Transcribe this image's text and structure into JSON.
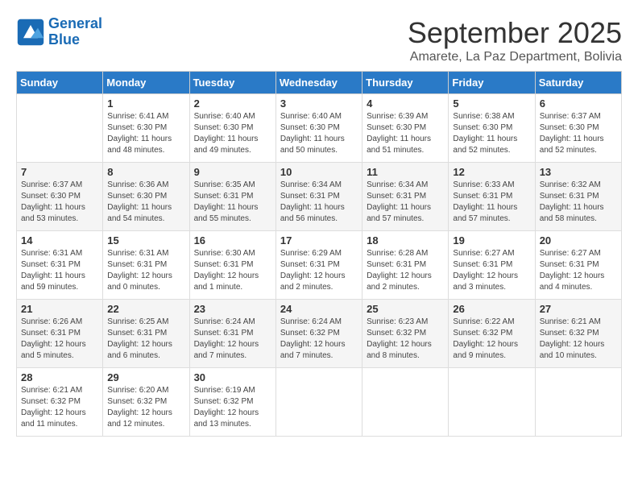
{
  "logo": {
    "line1": "General",
    "line2": "Blue"
  },
  "title": "September 2025",
  "subtitle": "Amarete, La Paz Department, Bolivia",
  "days_of_week": [
    "Sunday",
    "Monday",
    "Tuesday",
    "Wednesday",
    "Thursday",
    "Friday",
    "Saturday"
  ],
  "weeks": [
    [
      {
        "day": "",
        "info": ""
      },
      {
        "day": "1",
        "info": "Sunrise: 6:41 AM\nSunset: 6:30 PM\nDaylight: 11 hours\nand 48 minutes."
      },
      {
        "day": "2",
        "info": "Sunrise: 6:40 AM\nSunset: 6:30 PM\nDaylight: 11 hours\nand 49 minutes."
      },
      {
        "day": "3",
        "info": "Sunrise: 6:40 AM\nSunset: 6:30 PM\nDaylight: 11 hours\nand 50 minutes."
      },
      {
        "day": "4",
        "info": "Sunrise: 6:39 AM\nSunset: 6:30 PM\nDaylight: 11 hours\nand 51 minutes."
      },
      {
        "day": "5",
        "info": "Sunrise: 6:38 AM\nSunset: 6:30 PM\nDaylight: 11 hours\nand 52 minutes."
      },
      {
        "day": "6",
        "info": "Sunrise: 6:37 AM\nSunset: 6:30 PM\nDaylight: 11 hours\nand 52 minutes."
      }
    ],
    [
      {
        "day": "7",
        "info": "Sunrise: 6:37 AM\nSunset: 6:30 PM\nDaylight: 11 hours\nand 53 minutes."
      },
      {
        "day": "8",
        "info": "Sunrise: 6:36 AM\nSunset: 6:30 PM\nDaylight: 11 hours\nand 54 minutes."
      },
      {
        "day": "9",
        "info": "Sunrise: 6:35 AM\nSunset: 6:31 PM\nDaylight: 11 hours\nand 55 minutes."
      },
      {
        "day": "10",
        "info": "Sunrise: 6:34 AM\nSunset: 6:31 PM\nDaylight: 11 hours\nand 56 minutes."
      },
      {
        "day": "11",
        "info": "Sunrise: 6:34 AM\nSunset: 6:31 PM\nDaylight: 11 hours\nand 57 minutes."
      },
      {
        "day": "12",
        "info": "Sunrise: 6:33 AM\nSunset: 6:31 PM\nDaylight: 11 hours\nand 57 minutes."
      },
      {
        "day": "13",
        "info": "Sunrise: 6:32 AM\nSunset: 6:31 PM\nDaylight: 11 hours\nand 58 minutes."
      }
    ],
    [
      {
        "day": "14",
        "info": "Sunrise: 6:31 AM\nSunset: 6:31 PM\nDaylight: 11 hours\nand 59 minutes."
      },
      {
        "day": "15",
        "info": "Sunrise: 6:31 AM\nSunset: 6:31 PM\nDaylight: 12 hours\nand 0 minutes."
      },
      {
        "day": "16",
        "info": "Sunrise: 6:30 AM\nSunset: 6:31 PM\nDaylight: 12 hours\nand 1 minute."
      },
      {
        "day": "17",
        "info": "Sunrise: 6:29 AM\nSunset: 6:31 PM\nDaylight: 12 hours\nand 2 minutes."
      },
      {
        "day": "18",
        "info": "Sunrise: 6:28 AM\nSunset: 6:31 PM\nDaylight: 12 hours\nand 2 minutes."
      },
      {
        "day": "19",
        "info": "Sunrise: 6:27 AM\nSunset: 6:31 PM\nDaylight: 12 hours\nand 3 minutes."
      },
      {
        "day": "20",
        "info": "Sunrise: 6:27 AM\nSunset: 6:31 PM\nDaylight: 12 hours\nand 4 minutes."
      }
    ],
    [
      {
        "day": "21",
        "info": "Sunrise: 6:26 AM\nSunset: 6:31 PM\nDaylight: 12 hours\nand 5 minutes."
      },
      {
        "day": "22",
        "info": "Sunrise: 6:25 AM\nSunset: 6:31 PM\nDaylight: 12 hours\nand 6 minutes."
      },
      {
        "day": "23",
        "info": "Sunrise: 6:24 AM\nSunset: 6:31 PM\nDaylight: 12 hours\nand 7 minutes."
      },
      {
        "day": "24",
        "info": "Sunrise: 6:24 AM\nSunset: 6:32 PM\nDaylight: 12 hours\nand 7 minutes."
      },
      {
        "day": "25",
        "info": "Sunrise: 6:23 AM\nSunset: 6:32 PM\nDaylight: 12 hours\nand 8 minutes."
      },
      {
        "day": "26",
        "info": "Sunrise: 6:22 AM\nSunset: 6:32 PM\nDaylight: 12 hours\nand 9 minutes."
      },
      {
        "day": "27",
        "info": "Sunrise: 6:21 AM\nSunset: 6:32 PM\nDaylight: 12 hours\nand 10 minutes."
      }
    ],
    [
      {
        "day": "28",
        "info": "Sunrise: 6:21 AM\nSunset: 6:32 PM\nDaylight: 12 hours\nand 11 minutes."
      },
      {
        "day": "29",
        "info": "Sunrise: 6:20 AM\nSunset: 6:32 PM\nDaylight: 12 hours\nand 12 minutes."
      },
      {
        "day": "30",
        "info": "Sunrise: 6:19 AM\nSunset: 6:32 PM\nDaylight: 12 hours\nand 13 minutes."
      },
      {
        "day": "",
        "info": ""
      },
      {
        "day": "",
        "info": ""
      },
      {
        "day": "",
        "info": ""
      },
      {
        "day": "",
        "info": ""
      }
    ]
  ]
}
